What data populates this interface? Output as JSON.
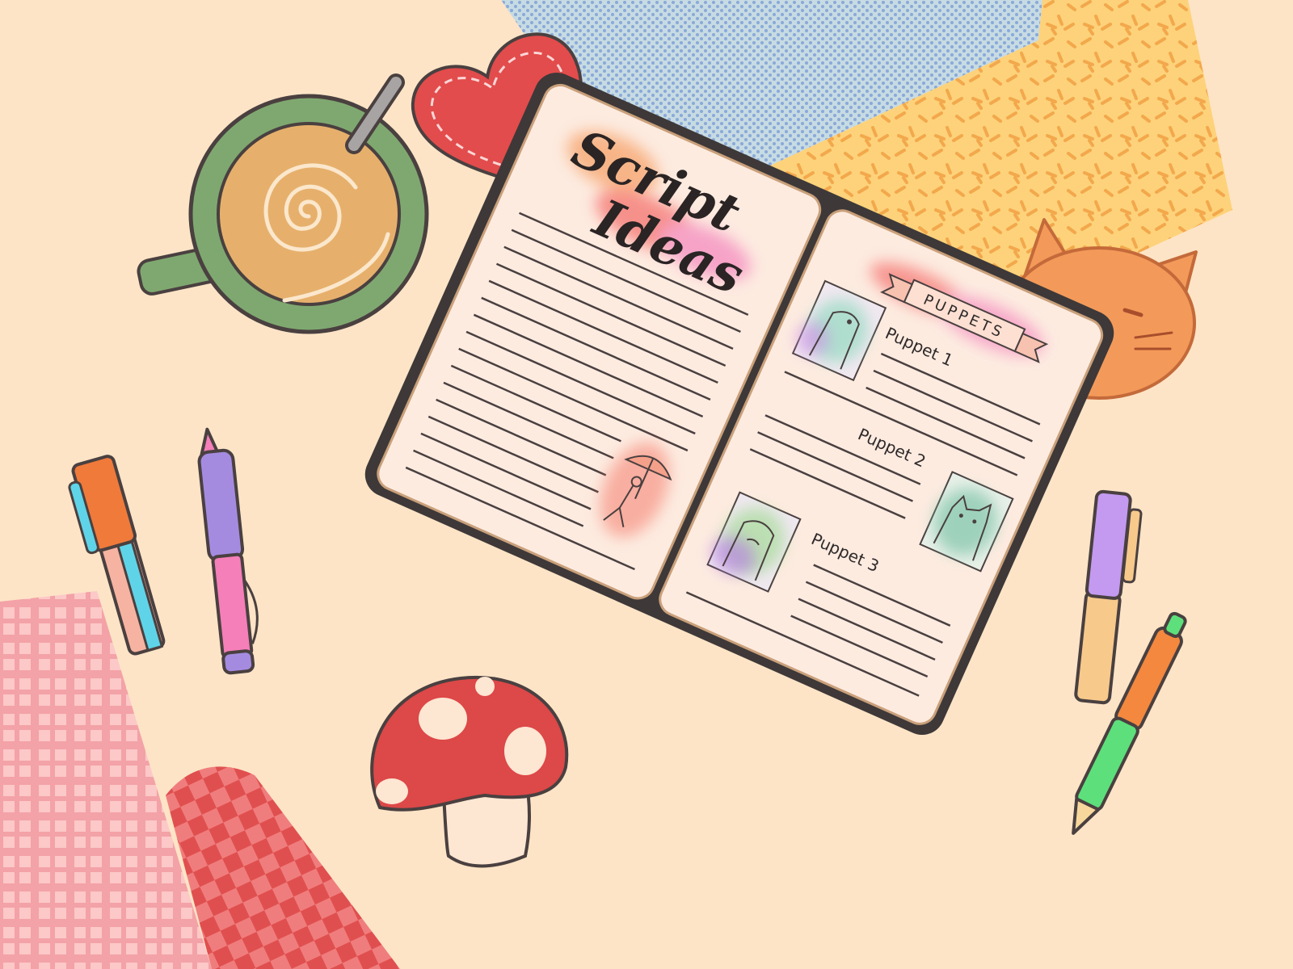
{
  "notebook": {
    "title_line1": "Script",
    "title_line2": "Ideas",
    "banner": "PUPPETS",
    "puppets": [
      {
        "label": "Puppet 1",
        "icon": "dinosaur-puppet"
      },
      {
        "label": "Puppet 2",
        "icon": "cat-puppet"
      },
      {
        "label": "Puppet 3",
        "icon": "mustache-puppet"
      }
    ]
  },
  "objects": [
    "coffee-cup",
    "heart-pillow",
    "cat-face",
    "pens",
    "mushroom",
    "patterned-papers"
  ],
  "colors": {
    "background": "#fde4c6",
    "outline": "#4a4040",
    "red": "#e24c4c",
    "orange": "#f39a5a",
    "green": "#7fa870",
    "purple": "#a58be0",
    "pink": "#f57fb8",
    "blue_paper": "#bcd7e4",
    "yellow_paper": "#fdd27a"
  }
}
